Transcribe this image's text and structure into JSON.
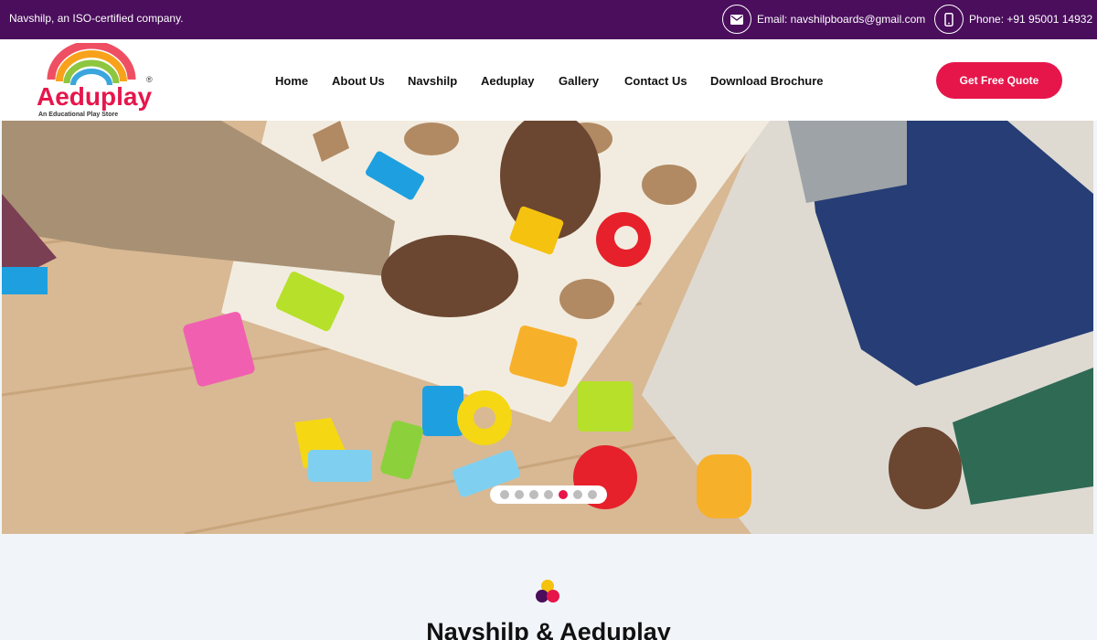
{
  "topbar": {
    "tagline": "Navshilp, an ISO-certified company.",
    "email": "Email: navshilpboards@gmail.com",
    "phone": "Phone: +91 95001 14932",
    "email_icon": "envelope-icon",
    "phone_icon": "mobile-phone-icon"
  },
  "logo": {
    "wordmark": "Aeduplay",
    "subtitle": "An Educational Play Store",
    "registered": "®"
  },
  "nav": {
    "items": [
      "Home",
      "About Us",
      "Navshilp",
      "Aeduplay",
      "Gallery",
      "Contact Us",
      "Download Brochure"
    ]
  },
  "cta": {
    "label": "Get Free Quote"
  },
  "hero": {
    "image": "children-playing-with-alphabet-puzzle",
    "slides_total": 7,
    "active_slide": 5
  },
  "section": {
    "title": "Navshilp & Aeduplay",
    "icon": "three-dots-logo-icon"
  },
  "colors": {
    "topbar": "#4a0e5c",
    "accent": "#e6164b",
    "section_bg": "#f1f5f9"
  }
}
